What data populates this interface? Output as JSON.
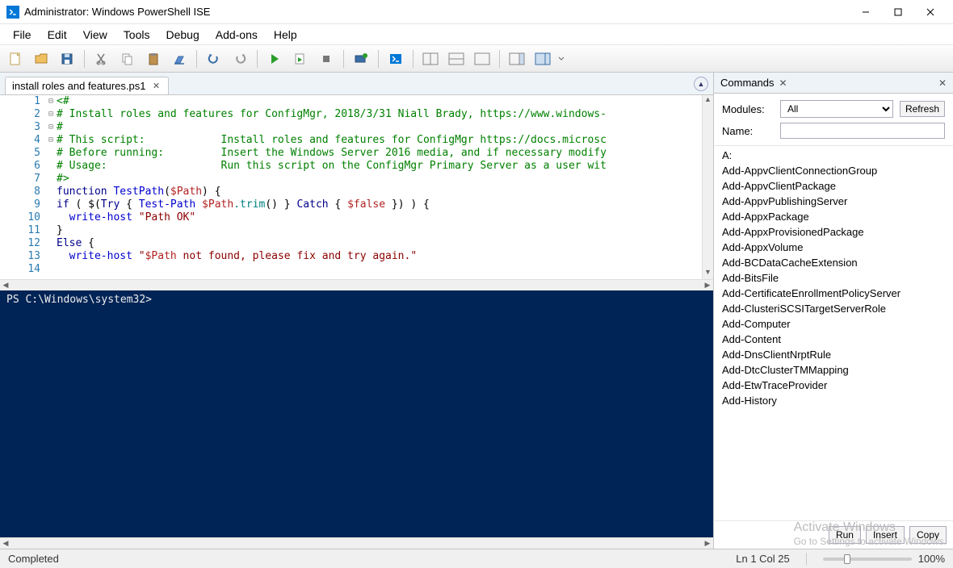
{
  "window": {
    "title": "Administrator: Windows PowerShell ISE"
  },
  "menu": [
    "File",
    "Edit",
    "View",
    "Tools",
    "Debug",
    "Add-ons",
    "Help"
  ],
  "tab": {
    "label": "install roles and features.ps1"
  },
  "code_lines": [
    "<#",
    "# Install roles and features for ConfigMgr, 2018/3/31 Niall Brady, https://www.windows-",
    "#",
    "# This script:            Install roles and features for ConfigMgr https://docs.microsc",
    "# Before running:         Insert the Windows Server 2016 media, and if necessary modify",
    "# Usage:                  Run this script on the ConfigMgr Primary Server as a user wit",
    "#>",
    "",
    "function TestPath($Path) {",
    "if ( $(Try { Test-Path $Path.trim() } Catch { $false }) ) {",
    "  write-host \"Path OK\"",
    "}",
    "Else {",
    "  write-host \"$Path not found, please fix and try again.\""
  ],
  "line_numbers": [
    1,
    2,
    3,
    4,
    5,
    6,
    7,
    8,
    9,
    10,
    11,
    12,
    13,
    14
  ],
  "console": {
    "prompt": "PS C:\\Windows\\system32>"
  },
  "commands_panel": {
    "title": "Commands",
    "modules_label": "Modules:",
    "modules_value": "All",
    "refresh_label": "Refresh",
    "name_label": "Name:",
    "name_value": "",
    "items": [
      "A:",
      "Add-AppvClientConnectionGroup",
      "Add-AppvClientPackage",
      "Add-AppvPublishingServer",
      "Add-AppxPackage",
      "Add-AppxProvisionedPackage",
      "Add-AppxVolume",
      "Add-BCDataCacheExtension",
      "Add-BitsFile",
      "Add-CertificateEnrollmentPolicyServer",
      "Add-ClusteriSCSITargetServerRole",
      "Add-Computer",
      "Add-Content",
      "Add-DnsClientNrptRule",
      "Add-DtcClusterTMMapping",
      "Add-EtwTraceProvider",
      "Add-History"
    ],
    "run_label": "Run",
    "insert_label": "Insert",
    "copy_label": "Copy"
  },
  "status": {
    "left": "Completed",
    "pos": "Ln 1  Col 25",
    "zoom": "100%"
  },
  "watermark": {
    "title": "Activate Windows",
    "sub": "Go to Settings to activate Windows."
  }
}
